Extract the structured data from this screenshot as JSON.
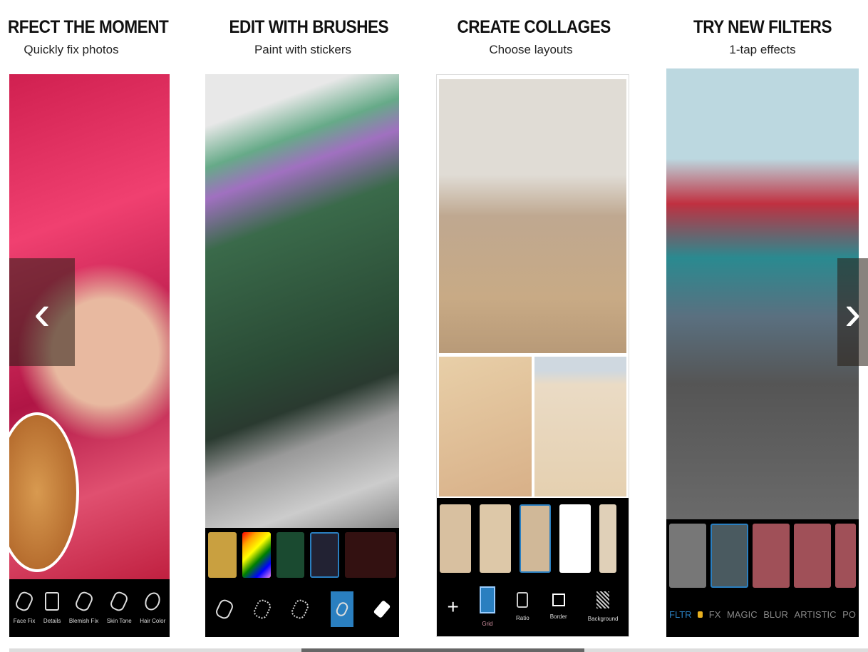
{
  "panels": [
    {
      "title": "RFECT THE MOMENT",
      "subtitle": "Quickly fix photos",
      "tools": [
        "Face Fix",
        "Details",
        "Blemish Fix",
        "Skin Tone",
        "Hair Color"
      ]
    },
    {
      "title": "EDIT WITH BRUSHES",
      "subtitle": "Paint with stickers"
    },
    {
      "title": "CREATE COLLAGES",
      "subtitle": "Choose layouts",
      "tools": [
        "+",
        "Grid",
        "Ratio",
        "Border",
        "Background"
      ]
    },
    {
      "title": "TRY NEW FILTERS",
      "subtitle": "1-tap effects",
      "tabs": [
        "FLTR",
        "FX",
        "MAGIC",
        "BLUR",
        "ARTISTIC",
        "PO"
      ]
    }
  ],
  "nav": {
    "prev": "‹",
    "next": "›"
  },
  "colors": {
    "accent": "#2a7fc0",
    "toolbar": "#000000"
  },
  "scroll_position_percent": 34
}
